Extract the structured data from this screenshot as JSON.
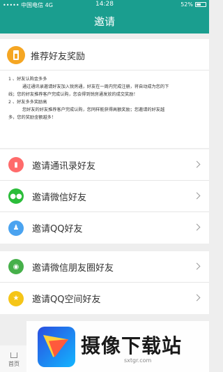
{
  "status_bar": {
    "carrier": "••••• 中国电信 4G",
    "time": "14:28",
    "battery": "52%",
    "battery_level": 0.52
  },
  "nav": {
    "title": "邀请"
  },
  "reward_card": {
    "title": "推荐好友奖励",
    "icon": "gift-icon",
    "lines": [
      "1 、好友认购金多多",
      "通过通讯录邀请好友加入锐房通，好友在一周内完成注册，将自动成为您的下",
      "线；您的好友推荐客户完成认购，您会得到锐房通发放的成交奖励！",
      "2 、好友多多奖励高",
      "您好友的好友推荐客户完成认购，您同样能获得高额奖励；您邀请的好友越",
      "多，您的奖励金额越多！"
    ]
  },
  "invite_group_1": [
    {
      "label": "邀请通讯录好友",
      "icon": "contacts-icon"
    },
    {
      "label": "邀请微信好友",
      "icon": "wechat-icon"
    },
    {
      "label": "邀请QQ好友",
      "icon": "qq-icon"
    }
  ],
  "invite_group_2": [
    {
      "label": "邀请微信朋友圈好友",
      "icon": "moments-icon"
    },
    {
      "label": "邀请QQ空间好友",
      "icon": "qzone-icon"
    }
  ],
  "tabbar": {
    "home_label": "首页"
  },
  "watermark": {
    "title": "摄像下载站",
    "url": "sxtgr.com"
  },
  "colors": {
    "brand": "#1a9e8f"
  }
}
